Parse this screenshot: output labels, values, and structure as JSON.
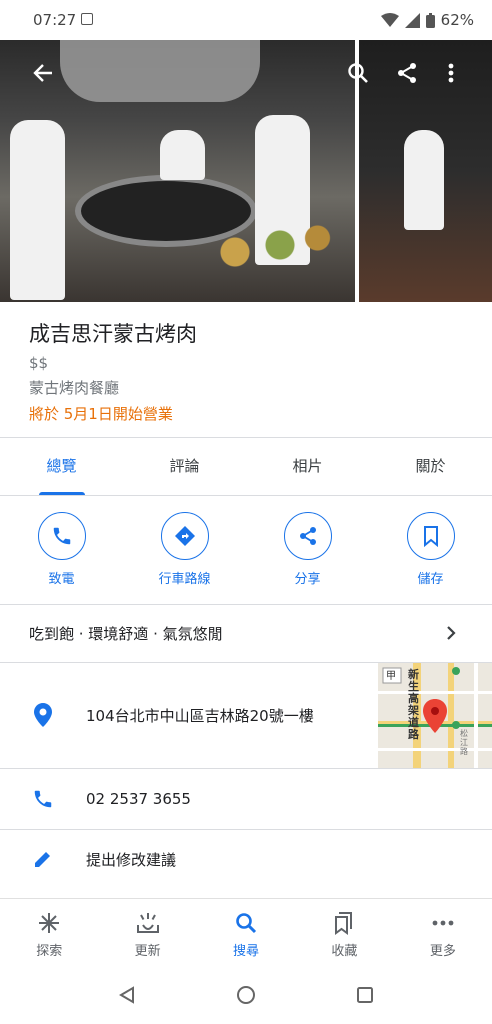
{
  "status_bar": {
    "time": "07:27",
    "battery": "62%"
  },
  "place": {
    "name": "成吉思汗蒙古烤肉",
    "price": "$$",
    "category": "蒙古烤肉餐廳",
    "hours_notice": "將於 5月1日開始營業"
  },
  "tabs": [
    {
      "label": "總覽",
      "active": true
    },
    {
      "label": "評論"
    },
    {
      "label": "相片"
    },
    {
      "label": "關於"
    }
  ],
  "actions": [
    {
      "label": "致電",
      "icon": "phone-icon"
    },
    {
      "label": "行車路線",
      "icon": "directions-icon"
    },
    {
      "label": "分享",
      "icon": "share-icon"
    },
    {
      "label": "儲存",
      "icon": "bookmark-icon"
    }
  ],
  "highlights": "吃到飽 · 環境舒適 · 氣氛悠閒",
  "address": "104台北市中山區吉林路20號一樓",
  "phone": "02 2537 3655",
  "suggest_edit": "提出修改建議",
  "map_labels": {
    "station": "甲",
    "street_main": "新生高架道路",
    "street_side": "松江路"
  },
  "bottom_nav": [
    {
      "label": "探索",
      "icon": "explore-icon"
    },
    {
      "label": "更新",
      "icon": "updates-icon"
    },
    {
      "label": "搜尋",
      "icon": "search-icon",
      "active": true
    },
    {
      "label": "收藏",
      "icon": "saved-icon"
    },
    {
      "label": "更多",
      "icon": "more-icon"
    }
  ],
  "colors": {
    "accent": "#1a73e8",
    "warning": "#e8710a",
    "pin": "#ea4335"
  }
}
